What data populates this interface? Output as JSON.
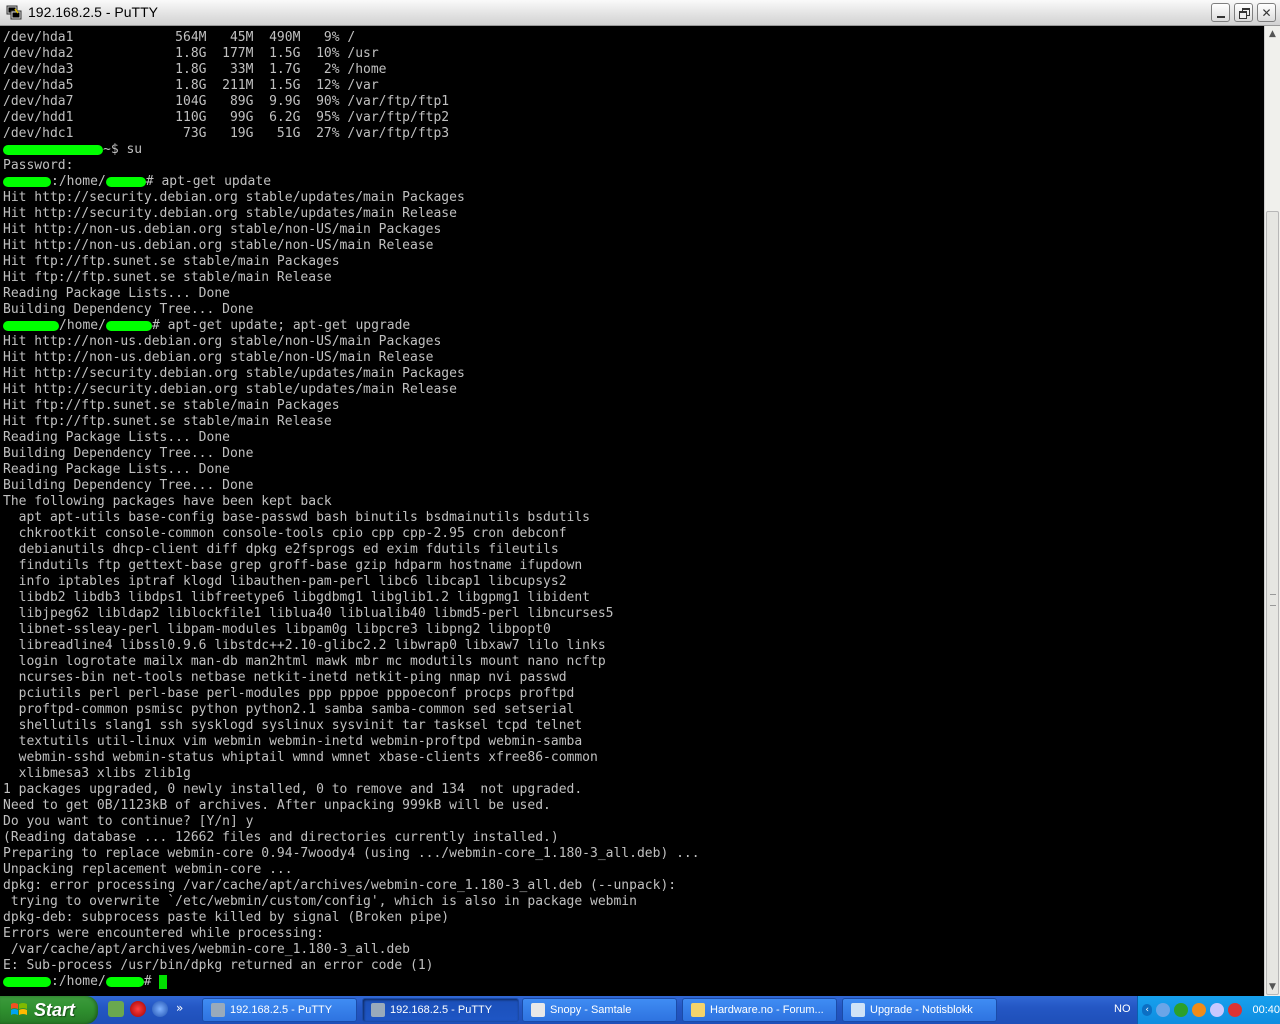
{
  "window": {
    "title": "192.168.2.5 - PuTTY"
  },
  "terminal": {
    "lines": [
      "/dev/hda1             564M   45M  490M   9% /",
      "/dev/hda2             1.8G  177M  1.5G  10% /usr",
      "/dev/hda3             1.8G   33M  1.7G   2% /home",
      "/dev/hda5             1.8G  211M  1.5G  12% /var",
      "/dev/hda7             104G   89G  9.9G  90% /var/ftp/ftp1",
      "/dev/hdd1             110G   99G  6.2G  95% /var/ftp/ftp2",
      "/dev/hdc1              73G   19G   51G  27% /var/ftp/ftp3",
      "~$ su",
      "Password:",
      ":/home/# apt-get update",
      "Hit http://security.debian.org stable/updates/main Packages",
      "Hit http://security.debian.org stable/updates/main Release",
      "Hit http://non-us.debian.org stable/non-US/main Packages",
      "Hit http://non-us.debian.org stable/non-US/main Release",
      "Hit ftp://ftp.sunet.se stable/main Packages",
      "Hit ftp://ftp.sunet.se stable/main Release",
      "Reading Package Lists... Done",
      "Building Dependency Tree... Done",
      "/home/# apt-get update; apt-get upgrade",
      "Hit http://non-us.debian.org stable/non-US/main Packages",
      "Hit http://non-us.debian.org stable/non-US/main Release",
      "Hit http://security.debian.org stable/updates/main Packages",
      "Hit http://security.debian.org stable/updates/main Release",
      "Hit ftp://ftp.sunet.se stable/main Packages",
      "Hit ftp://ftp.sunet.se stable/main Release",
      "Reading Package Lists... Done",
      "Building Dependency Tree... Done",
      "Reading Package Lists... Done",
      "Building Dependency Tree... Done",
      "The following packages have been kept back",
      "  apt apt-utils base-config base-passwd bash binutils bsdmainutils bsdutils",
      "  chkrootkit console-common console-tools cpio cpp cpp-2.95 cron debconf",
      "  debianutils dhcp-client diff dpkg e2fsprogs ed exim fdutils fileutils",
      "  findutils ftp gettext-base grep groff-base gzip hdparm hostname ifupdown",
      "  info iptables iptraf klogd libauthen-pam-perl libc6 libcap1 libcupsys2",
      "  libdb2 libdb3 libdps1 libfreetype6 libgdbmg1 libglib1.2 libgpmg1 libident",
      "  libjpeg62 libldap2 liblockfile1 liblua40 liblualib40 libmd5-perl libncurses5",
      "  libnet-ssleay-perl libpam-modules libpam0g libpcre3 libpng2 libpopt0",
      "  libreadline4 libssl0.9.6 libstdc++2.10-glibc2.2 libwrap0 libxaw7 lilo links",
      "  login logrotate mailx man-db man2html mawk mbr mc modutils mount nano ncftp",
      "  ncurses-bin net-tools netbase netkit-inetd netkit-ping nmap nvi passwd",
      "  pciutils perl perl-base perl-modules ppp pppoe pppoeconf procps proftpd",
      "  proftpd-common psmisc python python2.1 samba samba-common sed setserial",
      "  shellutils slang1 ssh sysklogd syslinux sysvinit tar tasksel tcpd telnet",
      "  textutils util-linux vim webmin webmin-inetd webmin-proftpd webmin-samba",
      "  webmin-sshd webmin-status whiptail wmnd wmnet xbase-clients xfree86-common",
      "  xlibmesa3 xlibs zlib1g",
      "1 packages upgraded, 0 newly installed, 0 to remove and 134  not upgraded.",
      "Need to get 0B/1123kB of archives. After unpacking 999kB will be used.",
      "Do you want to continue? [Y/n] y",
      "(Reading database ... 12662 files and directories currently installed.)",
      "Preparing to replace webmin-core 0.94-7woody4 (using .../webmin-core_1.180-3_all.deb) ...",
      "Unpacking replacement webmin-core ...",
      "dpkg: error processing /var/cache/apt/archives/webmin-core_1.180-3_all.deb (--unpack):",
      " trying to overwrite `/etc/webmin/custom/config', which is also in package webmin",
      "dpkg-deb: subprocess paste killed by signal (Broken pipe)",
      "Errors were encountered while processing:",
      " /var/cache/apt/archives/webmin-core_1.180-3_all.deb",
      "E: Sub-process /usr/bin/dpkg returned an error code (1)",
      ":/home/# "
    ]
  },
  "taskbar": {
    "start_label": "Start",
    "quicklaunch_more": "»",
    "tasks": [
      {
        "label": "192.168.2.5 - PuTTY"
      },
      {
        "label": "192.168.2.5 - PuTTY"
      },
      {
        "label": "Snopy - Samtale"
      },
      {
        "label": "Hardware.no - Forum..."
      },
      {
        "label": "Upgrade - Notisblokk"
      }
    ],
    "language": "NO",
    "clock": "00:40"
  },
  "colors": {
    "terminal_bg": "#000000",
    "terminal_fg": "#c0c0c0",
    "redaction": "#00ff00",
    "taskbar": "#245edb",
    "start_button": "#2f8f2f"
  }
}
